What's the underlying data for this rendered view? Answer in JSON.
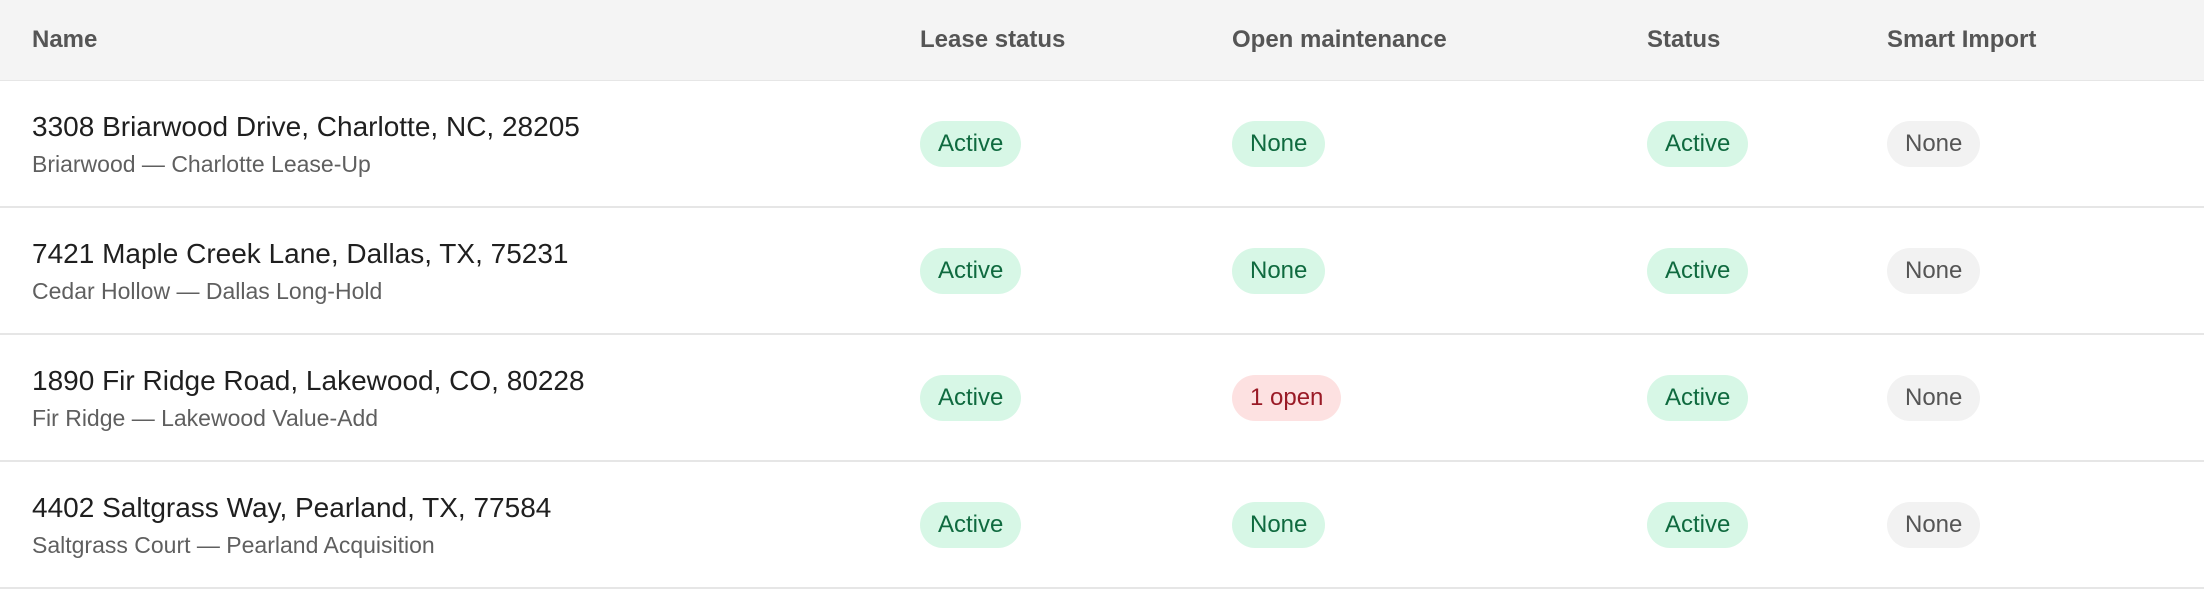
{
  "headers": {
    "name": "Name",
    "lease_status": "Lease status",
    "open_maintenance": "Open maintenance",
    "status": "Status",
    "smart_import": "Smart Import"
  },
  "rows": [
    {
      "address": "3308 Briarwood Drive, Charlotte, NC, 28205",
      "property": "Briarwood — Charlotte Lease-Up",
      "lease_status": "Active",
      "open_maintenance": "None",
      "status": "Active",
      "smart_import": "None"
    },
    {
      "address": "7421 Maple Creek Lane, Dallas, TX, 75231",
      "property": "Cedar Hollow — Dallas Long-Hold",
      "lease_status": "Active",
      "open_maintenance": "None",
      "status": "Active",
      "smart_import": "None"
    },
    {
      "address": "1890 Fir Ridge Road, Lakewood, CO, 80228",
      "property": "Fir Ridge — Lakewood Value-Add",
      "lease_status": "Active",
      "open_maintenance": "1 open",
      "status": "Active",
      "smart_import": "None"
    },
    {
      "address": "4402 Saltgrass Way, Pearland, TX, 77584",
      "property": "Saltgrass Court — Pearland Acquisition",
      "lease_status": "Active",
      "open_maintenance": "None",
      "status": "Active",
      "smart_import": "None"
    }
  ],
  "colors": {
    "green_bg": "#d7f7e6",
    "green_text": "#0f6a3f",
    "red_bg": "#fde1e1",
    "red_text": "#9a1a26",
    "gray_bg": "#f2f2f2",
    "gray_text": "#555555",
    "header_bg": "#f4f4f4"
  }
}
